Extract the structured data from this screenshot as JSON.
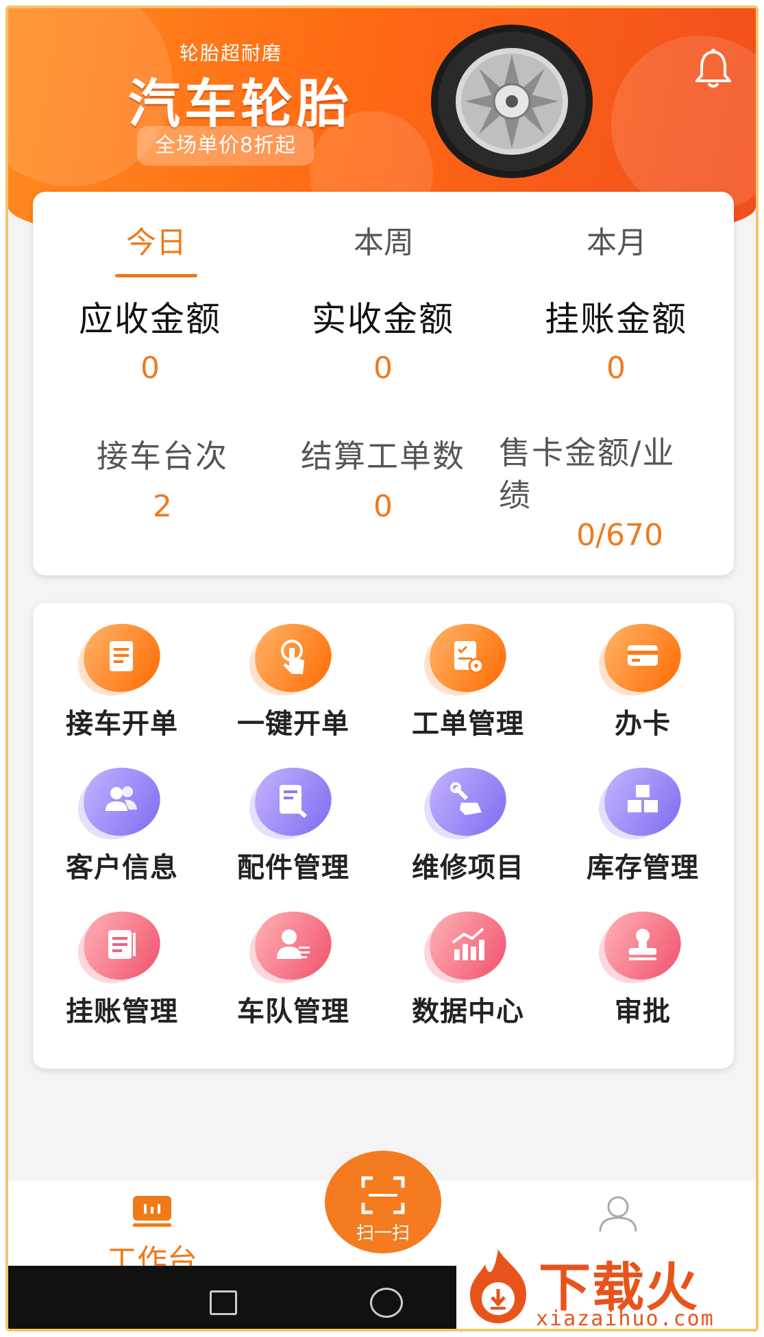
{
  "banner": {
    "subtitle": "轮胎超耐磨",
    "title": "汽车轮胎",
    "promo": "全场单价8折起"
  },
  "stats": {
    "tabs": [
      {
        "label": "今日",
        "active": true
      },
      {
        "label": "本周",
        "active": false
      },
      {
        "label": "本月",
        "active": false
      }
    ],
    "row1": [
      {
        "label": "应收金额",
        "value": "0"
      },
      {
        "label": "实收金额",
        "value": "0"
      },
      {
        "label": "挂账金额",
        "value": "0"
      }
    ],
    "row2": [
      {
        "label": "接车台次",
        "value": "2"
      },
      {
        "label": "结算工单数",
        "value": "0"
      },
      {
        "label": "售卡金额/业绩",
        "value": "0/670"
      }
    ]
  },
  "grid": {
    "items": [
      {
        "label": "接车开单",
        "icon": "document-icon",
        "color": "#ff7a12"
      },
      {
        "label": "一键开单",
        "icon": "tap-hand-icon",
        "color": "#ff7a12"
      },
      {
        "label": "工单管理",
        "icon": "work-order-gear-icon",
        "color": "#ff7a12"
      },
      {
        "label": "办卡",
        "icon": "credit-card-icon",
        "color": "#ff7a12"
      },
      {
        "label": "客户信息",
        "icon": "customers-icon",
        "color": "#8b7cf4"
      },
      {
        "label": "配件管理",
        "icon": "parts-doc-wrench-icon",
        "color": "#8b7cf4"
      },
      {
        "label": "维修项目",
        "icon": "wrench-hand-icon",
        "color": "#8b7cf4"
      },
      {
        "label": "库存管理",
        "icon": "boxes-icon",
        "color": "#8b7cf4"
      },
      {
        "label": "挂账管理",
        "icon": "ledger-icon",
        "color": "#f2607a"
      },
      {
        "label": "车队管理",
        "icon": "fleet-person-icon",
        "color": "#f2607a"
      },
      {
        "label": "数据中心",
        "icon": "bar-chart-icon",
        "color": "#f2607a"
      },
      {
        "label": "审批",
        "icon": "stamp-icon",
        "color": "#f2607a"
      }
    ]
  },
  "nav": {
    "workbench": "工作台",
    "scan": "扫一扫",
    "mine": "我的"
  },
  "watermark": {
    "brand": "下载火",
    "domain": "xiazaihuo.com"
  },
  "colors": {
    "accent": "#f07a18",
    "banner": "#ff6a14"
  }
}
